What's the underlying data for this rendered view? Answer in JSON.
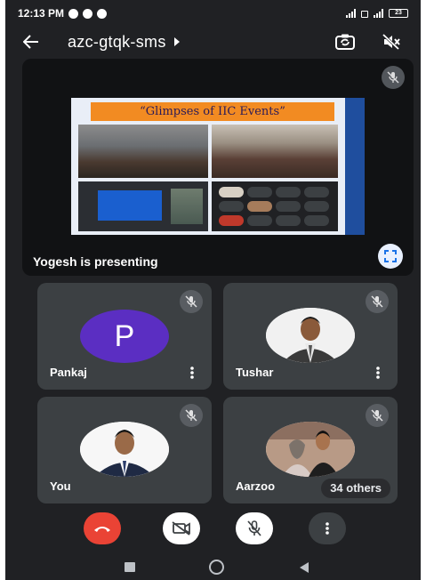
{
  "status_bar": {
    "time": "12:13 PM",
    "battery": "23"
  },
  "meeting": {
    "title": "azc-gtqk-sms"
  },
  "icons": {
    "back": "arrow-left-icon",
    "title_caret": "caret-right-icon",
    "switch_camera": "switch-camera-icon",
    "audio_output": "speaker-off-icon",
    "muted": "mic-off-icon",
    "fullscreen": "fullscreen-icon",
    "more": "more-vert-icon"
  },
  "presentation": {
    "slide_title": "“Glimpses of IIC Events”",
    "presenter_label": "Yogesh is presenting"
  },
  "participants": [
    {
      "name": "Pankaj",
      "avatar_letter": "P",
      "muted": true
    },
    {
      "name": "Tushar",
      "muted": true
    },
    {
      "name": "You",
      "muted": true
    },
    {
      "name": "Aarzoo",
      "muted": true
    }
  ],
  "others_chip": "34 others",
  "colors": {
    "background": "#202124",
    "tile": "#3c4043",
    "end_call": "#ea4335",
    "avatar_p": "#5b2ec2",
    "slide_title_bg": "#f28b22"
  }
}
